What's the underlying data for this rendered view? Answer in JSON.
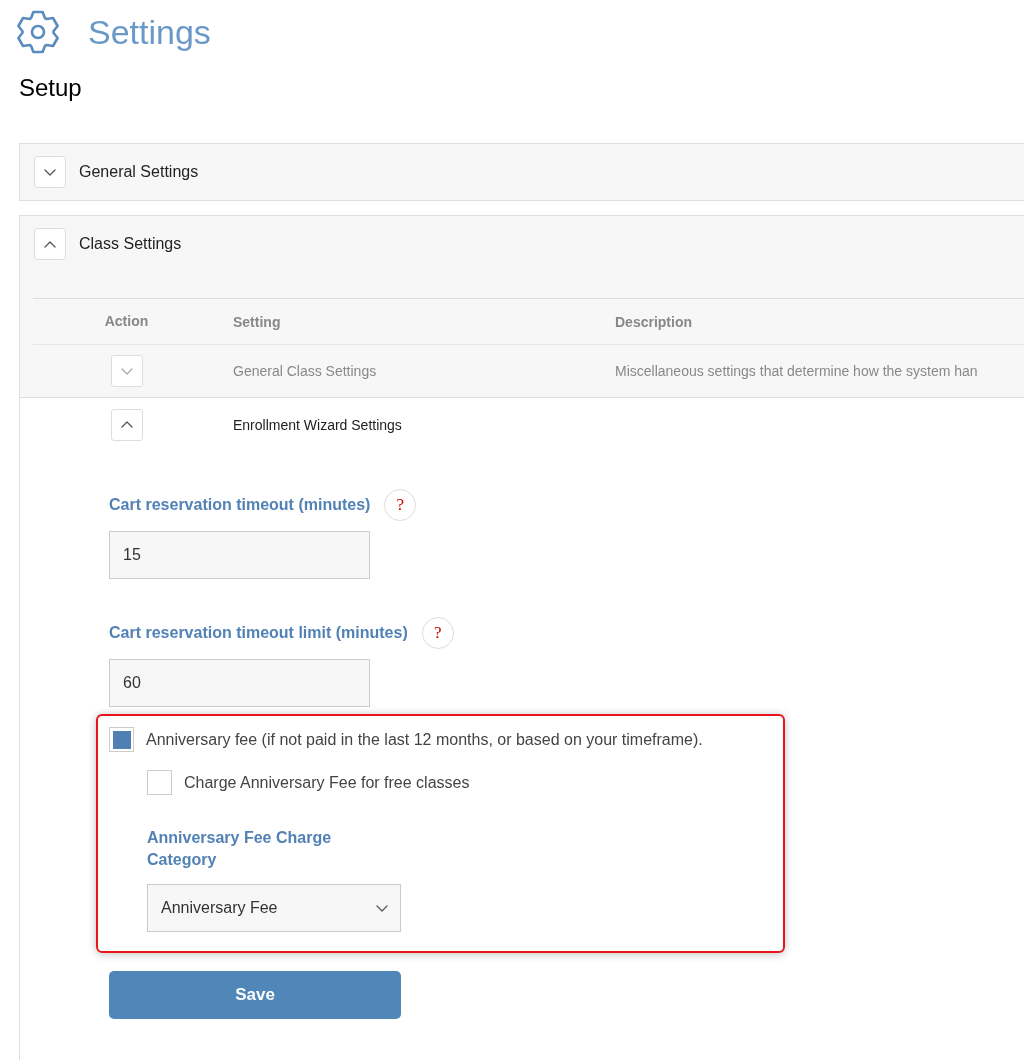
{
  "header": {
    "title": "Settings"
  },
  "subtitle": "Setup",
  "sections": [
    {
      "title": "General Settings",
      "expanded": false
    },
    {
      "title": "Class Settings",
      "expanded": true,
      "table": {
        "columns": [
          "Action",
          "Setting",
          "Description"
        ],
        "rows": [
          {
            "setting": "General Class Settings",
            "description": "Miscellaneous settings that determine how the system han",
            "expanded": false
          },
          {
            "setting": "Enrollment Wizard Settings",
            "expanded": true,
            "fields": [
              {
                "label": "Cart reservation timeout (minutes)",
                "value": "15",
                "help": "?"
              },
              {
                "label": "Cart reservation timeout limit (minutes)",
                "value": "60",
                "help": "?"
              }
            ],
            "options": [
              {
                "kind": "checkbox",
                "label": "Anniversary fee (if not paid in the last 12 months, or based on your timeframe).",
                "checked": true,
                "highlighted": true,
                "children": [
                  {
                    "kind": "checkbox",
                    "label": "Charge Anniversary Fee for free classes",
                    "checked": false
                  },
                  {
                    "kind": "select",
                    "label": "Anniversary Fee Charge Category",
                    "value": "Anniversary Fee"
                  }
                ]
              }
            ],
            "save": "Save"
          }
        ]
      }
    }
  ]
}
